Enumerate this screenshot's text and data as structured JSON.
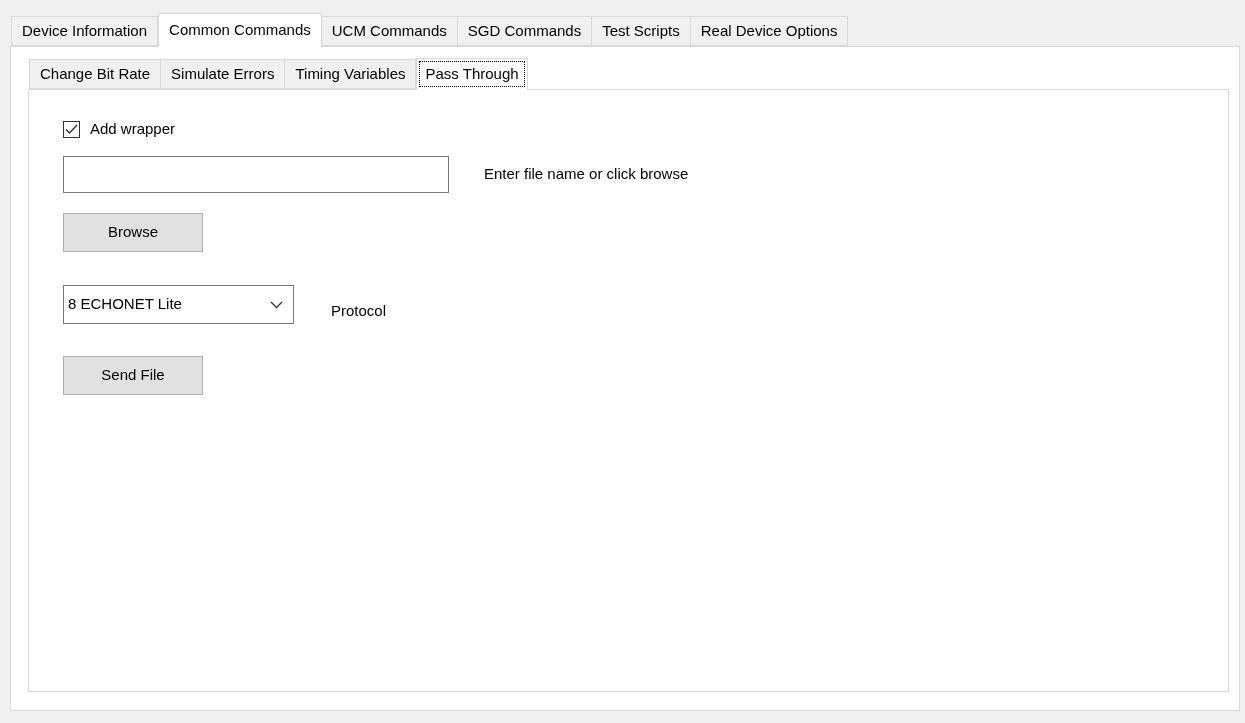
{
  "tabs": [
    {
      "label": "Device Information",
      "selected": false
    },
    {
      "label": "Common Commands",
      "selected": true
    },
    {
      "label": "UCM Commands",
      "selected": false
    },
    {
      "label": "SGD Commands",
      "selected": false
    },
    {
      "label": "Test Scripts",
      "selected": false
    },
    {
      "label": "Real Device Options",
      "selected": false
    }
  ],
  "subtabs": [
    {
      "label": "Change Bit Rate",
      "selected": false
    },
    {
      "label": "Simulate Errors",
      "selected": false
    },
    {
      "label": "Timing Variables",
      "selected": false
    },
    {
      "label": "Pass Through",
      "selected": true
    }
  ],
  "add_wrapper": {
    "label": "Add wrapper",
    "checked": true
  },
  "file_field": {
    "hint_label": "Enter file name or click browse"
  },
  "browse_button": "Browse",
  "protocol": {
    "value": "8 ECHONET Lite",
    "label": "Protocol"
  },
  "send_button": "Send File"
}
